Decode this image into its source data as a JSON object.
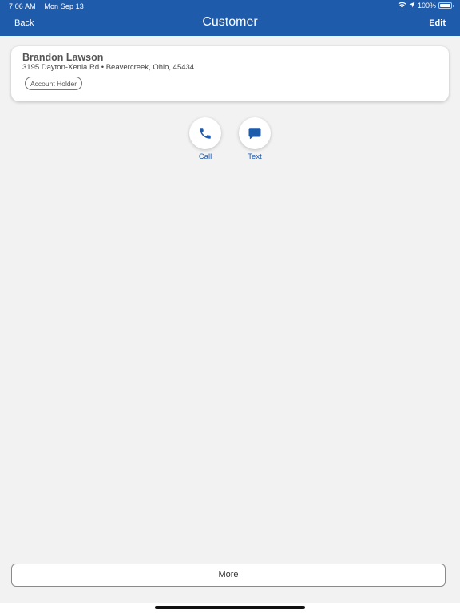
{
  "status_bar": {
    "time": "7:06 AM",
    "date": "Mon Sep 13",
    "battery": "100%"
  },
  "nav": {
    "back_label": "Back",
    "title": "Customer",
    "edit_label": "Edit"
  },
  "customer": {
    "name": "Brandon Lawson",
    "address": "3195 Dayton-Xenia Rd • Beavercreek, Ohio, 45434",
    "badge": "Account Holder"
  },
  "actions": [
    {
      "label": "Call",
      "icon": "phone-icon"
    },
    {
      "label": "Text",
      "icon": "chat-bubble-icon"
    }
  ],
  "more_label": "More",
  "colors": {
    "accent": "#1f5bab",
    "background": "#f2f2f2"
  }
}
